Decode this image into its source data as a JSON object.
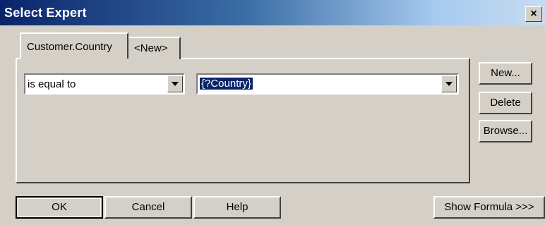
{
  "window": {
    "title": "Select Expert",
    "close_glyph": "×"
  },
  "tabs": [
    {
      "label": "Customer.Country",
      "active": true
    },
    {
      "label": "<New>",
      "active": false
    }
  ],
  "criteria": {
    "operator_value": "is equal to",
    "parameter_value": "{?Country}"
  },
  "side_buttons": {
    "new": "New...",
    "delete": "Delete",
    "browse": "Browse..."
  },
  "bottom_buttons": {
    "ok": "OK",
    "cancel": "Cancel",
    "help": "Help",
    "show_formula": "Show Formula >>>"
  }
}
